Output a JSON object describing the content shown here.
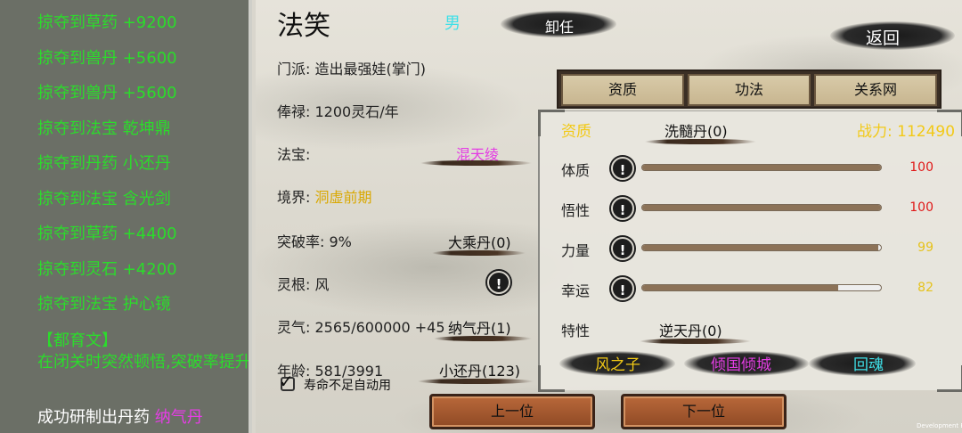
{
  "log": {
    "lines": [
      "掠夺到草药 +9200",
      "掠夺到兽丹 +5600",
      "掠夺到兽丹 +5600",
      "掠夺到法宝 乾坤鼎",
      "掠夺到丹药 小还丹",
      "掠夺到法宝 含光剑",
      "掠夺到草药 +4400",
      "掠夺到灵石 +4200",
      "掠夺到法宝 护心镜"
    ],
    "event_title": "【都育文】",
    "event_desc": "在闭关时突然顿悟,突破率提升",
    "craft_prefix": "成功研制出丹药",
    "craft_item": "纳气丹"
  },
  "character": {
    "name": "法笑",
    "gender": "男",
    "dismiss_label": "卸任",
    "back_label": "返回",
    "sect": "门派: 造出最强娃(掌门)",
    "salary": "俸禄: 1200灵石/年",
    "treasure_label": "法宝:",
    "treasure_value": "混天绫",
    "realm_label": "境界:",
    "realm_value": "洞虚前期",
    "breakthrough": "突破率: 9%",
    "breakthrough_pill": "大乘丹(0)",
    "root": "灵根: 风",
    "qi": "灵气: 2565/600000 +45",
    "qi_pill": "纳气丹(1)",
    "age": "年龄: 581/3991",
    "age_pill": "小还丹(123)",
    "auto_use_label": "寿命不足自动用"
  },
  "tabs": [
    "资质",
    "功法",
    "关系网"
  ],
  "stats": {
    "section_title": "资质",
    "wash_pill": "洗髓丹(0)",
    "power_label": "战力: 112490",
    "rows": [
      {
        "label": "体质",
        "value": "100",
        "fill": 1.0,
        "color": "#e01818"
      },
      {
        "label": "悟性",
        "value": "100",
        "fill": 1.0,
        "color": "#e01818"
      },
      {
        "label": "力量",
        "value": "99",
        "fill": 0.99,
        "color": "#e6c21a"
      },
      {
        "label": "幸运",
        "value": "82",
        "fill": 0.82,
        "color": "#e6c21a"
      }
    ],
    "trait_label": "特性",
    "trait_pill": "逆天丹(0)",
    "traits": [
      {
        "name": "风之子",
        "color": "#f2c916"
      },
      {
        "name": "倾国倾城",
        "color": "#e43de4"
      },
      {
        "name": "回魂",
        "color": "#3fe0e8"
      }
    ]
  },
  "nav": {
    "prev_label": "上一位",
    "next_label": "下一位"
  },
  "footer": {
    "build_label": "Development Build"
  },
  "icons": {
    "info": "exclamation-circle-icon",
    "check": "checkmark-icon"
  },
  "colors": {
    "log_green": "#2bdc2b",
    "gold": "#f2c916",
    "magenta": "#e43de4",
    "cyan": "#3fe0e8"
  }
}
